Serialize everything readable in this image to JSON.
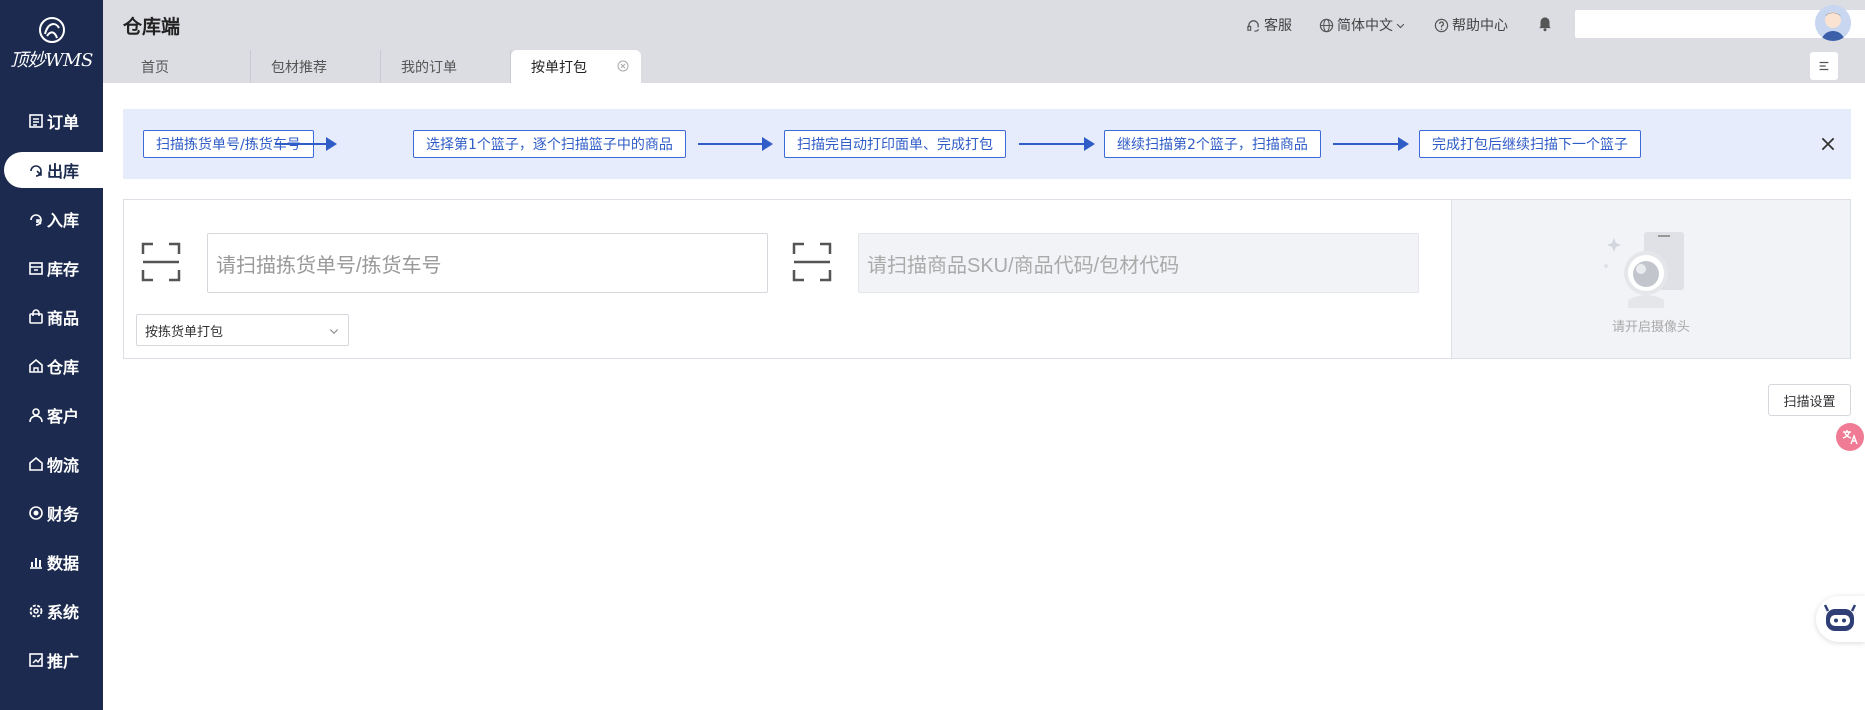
{
  "app": {
    "logo_text": "顶妙WMS",
    "title": "仓库端"
  },
  "sidebar": {
    "items": [
      {
        "label": "订单",
        "icon": "order-icon"
      },
      {
        "label": "出库",
        "icon": "outbound-icon",
        "active": true
      },
      {
        "label": "入库",
        "icon": "inbound-icon"
      },
      {
        "label": "库存",
        "icon": "inventory-icon"
      },
      {
        "label": "商品",
        "icon": "product-bag-icon"
      },
      {
        "label": "仓库",
        "icon": "warehouse-icon"
      },
      {
        "label": "客户",
        "icon": "customer-icon"
      },
      {
        "label": "物流",
        "icon": "logistics-icon"
      },
      {
        "label": "财务",
        "icon": "finance-icon"
      },
      {
        "label": "数据",
        "icon": "data-chart-icon"
      },
      {
        "label": "系统",
        "icon": "gear-icon"
      },
      {
        "label": "推广",
        "icon": "promotion-icon"
      }
    ]
  },
  "header": {
    "service": "客服",
    "language": "简体中文",
    "help": "帮助中心",
    "user_select_value": ""
  },
  "tabs": [
    {
      "label": "首页"
    },
    {
      "label": "包材推荐"
    },
    {
      "label": "我的订单"
    },
    {
      "label": "按单打包",
      "active": true
    }
  ],
  "steps": [
    "扫描拣货单号/拣货车号",
    "选择第1个篮子，逐个扫描篮子中的商品",
    "扫描完自动打印面单、完成打包",
    "继续扫描第2个篮子，扫描商品",
    "完成打包后继续扫描下一个篮子"
  ],
  "scan": {
    "pick_placeholder": "请扫描拣货单号/拣货车号",
    "sku_placeholder": "请扫描商品SKU/商品代码/包材代码",
    "mode_value": "按拣货单打包"
  },
  "camera": {
    "text": "请开启摄像头"
  },
  "scan_settings_label": "扫描设置",
  "colors": {
    "sidebar_bg": "#1b2a4e",
    "header_bg": "#dcdde3",
    "banner_bg": "#e7ecfc",
    "accent": "#2f5cc7"
  }
}
